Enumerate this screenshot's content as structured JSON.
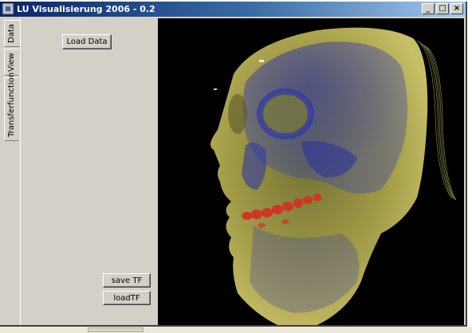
{
  "window": {
    "title": "LU Visualisierung 2006 - 0.2",
    "controls": {
      "minimize": "_",
      "maximize": "□",
      "close": "×"
    }
  },
  "tabs": [
    {
      "label": "Data",
      "active": true
    },
    {
      "label": "View",
      "active": false
    },
    {
      "label": "Transferfunction",
      "active": false
    }
  ],
  "panel": {
    "load_data": "Load Data",
    "save_tf": "save TF",
    "load_tf": "loadTF"
  },
  "viewport": {
    "content": "volume-rendered-skull",
    "colors": {
      "background": "#000000",
      "skin": "#c8c060",
      "bone": "#4048a8",
      "teeth": "#d03020"
    }
  }
}
